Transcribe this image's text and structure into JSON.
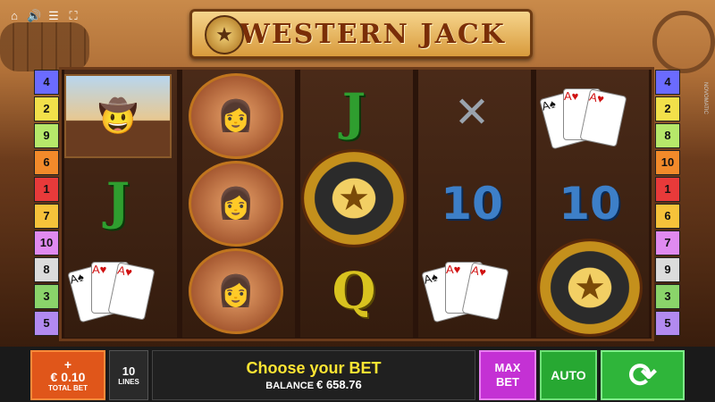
{
  "top_bar": {
    "icons": [
      "home-icon",
      "sound-icon",
      "menu-icon",
      "fullscreen-icon"
    ]
  },
  "logo": {
    "text": "WESTERN JACK"
  },
  "paylines_left": [
    "4",
    "2",
    "9",
    "6",
    "1",
    "7",
    "10",
    "8",
    "3",
    "5"
  ],
  "paylines_right": [
    "4",
    "2",
    "8",
    "10",
    "1",
    "6",
    "7",
    "9",
    "3",
    "5"
  ],
  "payline_colors": [
    "#6b6bff",
    "#f2e04a",
    "#b6e86a",
    "#f28a2a",
    "#e83a3a",
    "#f6c23a",
    "#e08af0",
    "#dcdcdc",
    "#8ad46a",
    "#b28af0"
  ],
  "reels": [
    [
      "cowboy",
      "J",
      "cards"
    ],
    [
      "woman",
      "woman",
      "woman"
    ],
    [
      "J",
      "sheriff-badge",
      "Q"
    ],
    [
      "revolvers",
      "10",
      "cards"
    ],
    [
      "cards",
      "10",
      "sheriff-badge"
    ]
  ],
  "controls": {
    "total_bet_plus": "+",
    "total_bet_amount": "€ 0.10",
    "total_bet_label": "TOTAL BET",
    "lines_count": "10",
    "lines_label": "LINES",
    "message": "Choose your BET",
    "balance_label": "BALANCE",
    "balance_value": "€ 658.76",
    "max_bet_label": "MAX BET",
    "auto_label": "AUTO",
    "spin_icon": "spin-arrows-icon"
  },
  "side_text": "NOVOMATIC"
}
